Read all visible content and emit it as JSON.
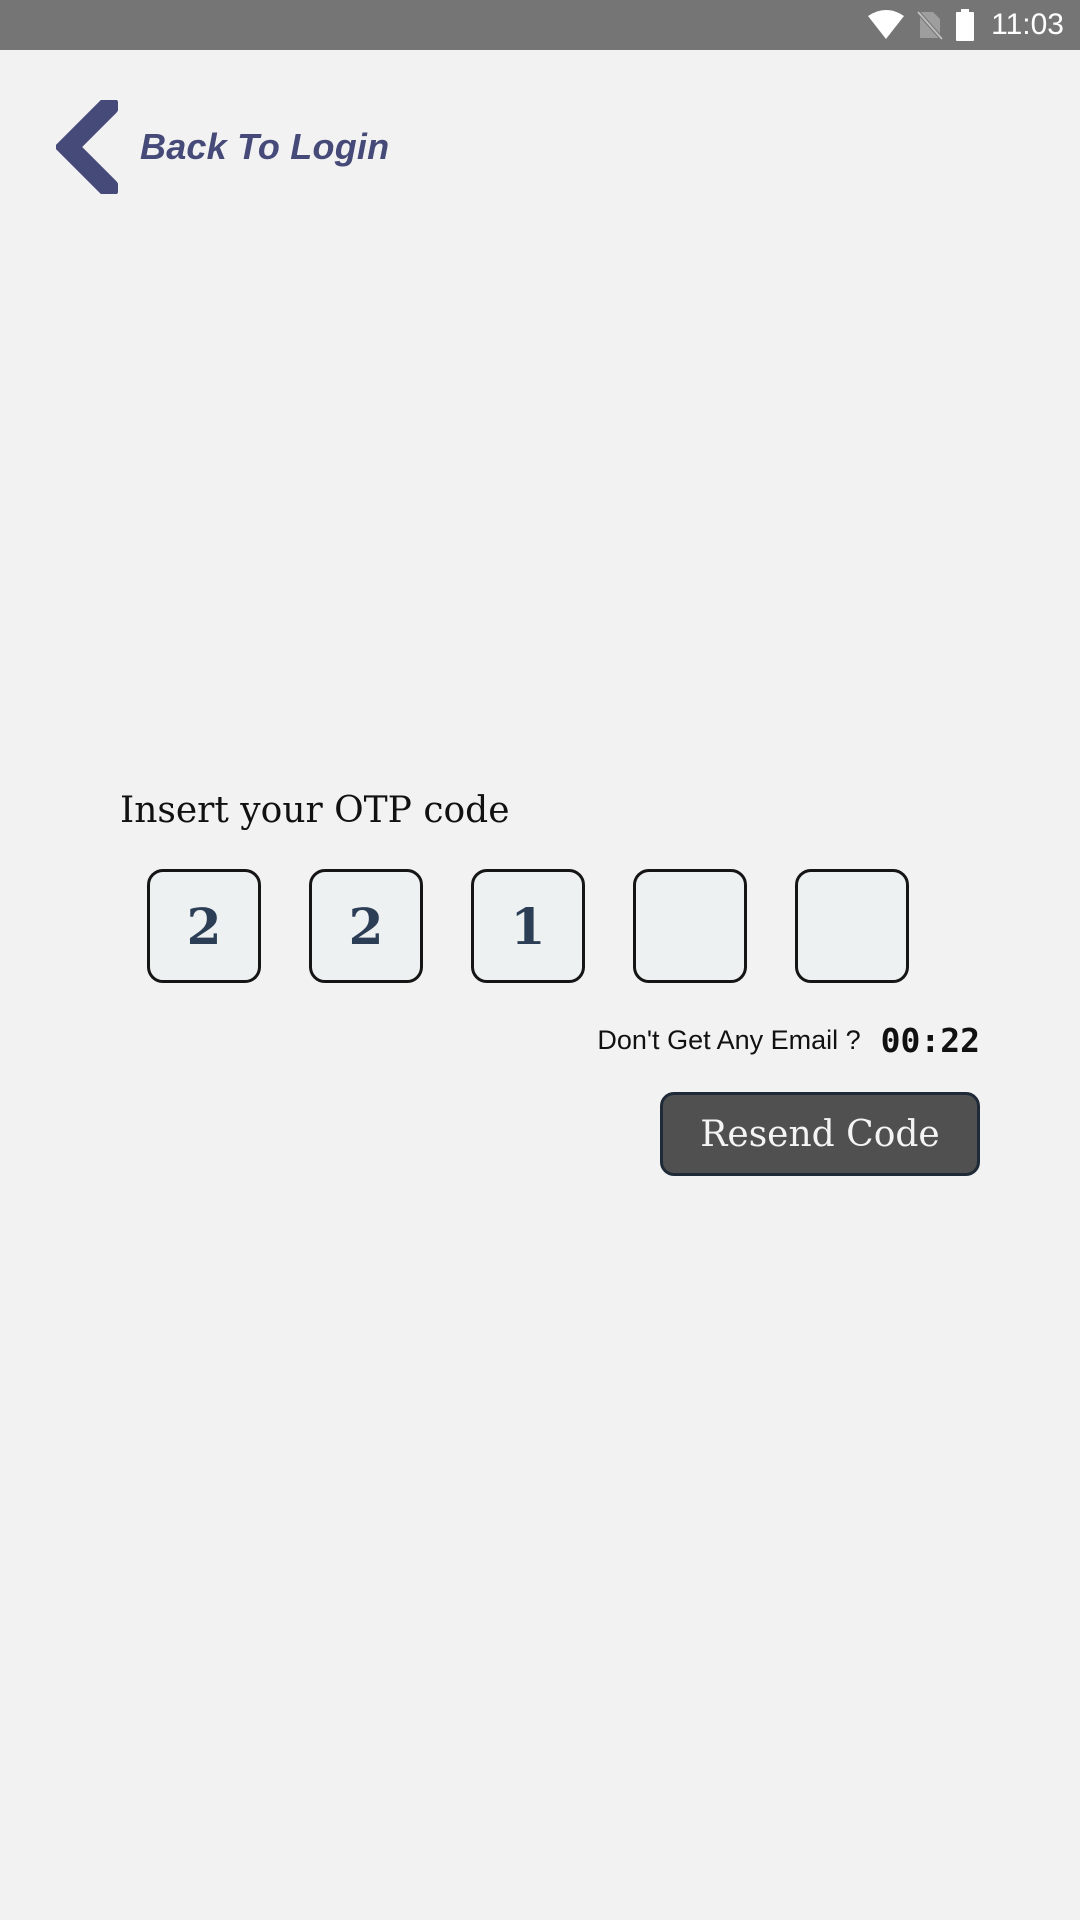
{
  "status_bar": {
    "time": "11:03",
    "icons": [
      "wifi-icon",
      "no-sim-icon",
      "battery-icon"
    ],
    "background": "#757575"
  },
  "header": {
    "back_label": "Back To Login",
    "back_icon": "chevron-left-icon",
    "accent_color": "#454a78"
  },
  "otp": {
    "title": "Insert your OTP code",
    "digits": [
      "2",
      "2",
      "1",
      "",
      ""
    ]
  },
  "resend": {
    "question": "Don't Get Any Email ?",
    "timer": "00:22",
    "button_label": "Resend Code"
  }
}
